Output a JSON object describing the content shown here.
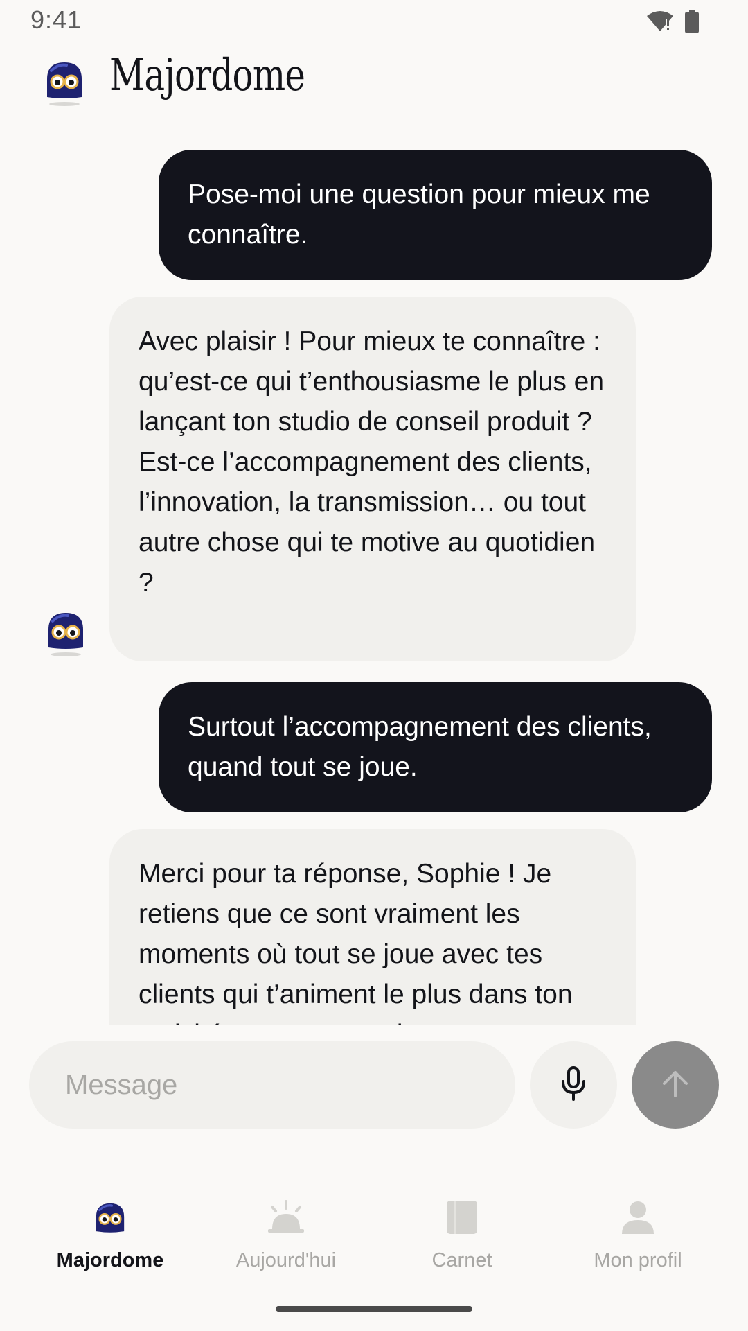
{
  "status_bar": {
    "time": "9:41",
    "icons": [
      "wifi-icon",
      "battery-icon"
    ]
  },
  "header": {
    "title": "Majordome",
    "avatar": "majordome-robot-icon"
  },
  "conversation": {
    "messages": [
      {
        "role": "user",
        "text": "Pose-moi une question pour mieux me connaître."
      },
      {
        "role": "assistant",
        "text": "Avec plaisir ! Pour mieux te connaître : qu’est-ce qui t’enthousiasme le plus en lançant ton studio de conseil produit ? Est-ce l’accompagnement des clients, l’innovation, la transmission… ou tout autre chose qui te motive au quotidien ?"
      },
      {
        "role": "user",
        "text": "Surtout l’accompagnement des clients, quand tout se joue."
      },
      {
        "role": "assistant",
        "text": "Merci pour ta réponse, Sophie ! Je retiens que ce sont vraiment les moments où tout se joue avec tes clients qui t’animent le plus dans ton activité. C’est une vraie"
      }
    ]
  },
  "composer": {
    "placeholder": "Message",
    "value": "",
    "mic_icon": "microphone-icon",
    "send_icon": "arrow-up-icon"
  },
  "nav": {
    "items": [
      {
        "label": "Majordome",
        "icon": "majordome-robot-icon",
        "active": true
      },
      {
        "label": "Aujourd'hui",
        "icon": "sunrise-icon",
        "active": false
      },
      {
        "label": "Carnet",
        "icon": "notebook-icon",
        "active": false
      },
      {
        "label": "Mon profil",
        "icon": "person-icon",
        "active": false
      }
    ]
  },
  "colors": {
    "background": "#faf9f7",
    "user_bubble": "#13141c",
    "assistant_bubble": "#f1f0ed",
    "robot_body": "#1e2270",
    "send_button": "#8a8a8a",
    "inactive": "#c8c7c3"
  }
}
